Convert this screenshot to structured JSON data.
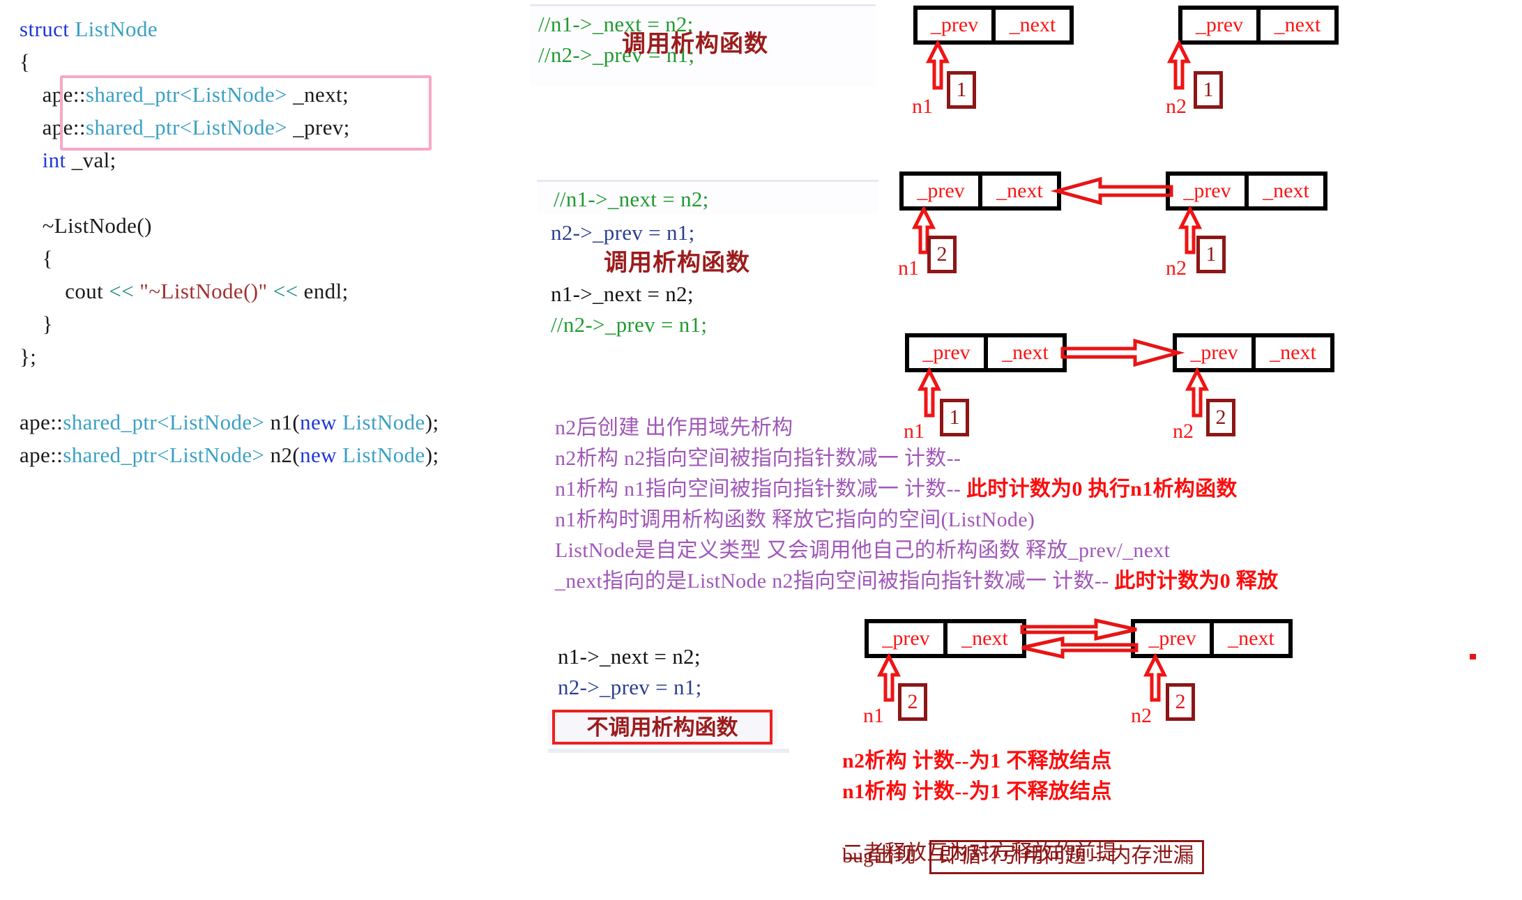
{
  "code_listing": {
    "lines": [
      [
        {
          "t": "struct ",
          "c": "kw"
        },
        {
          "t": "ListNode",
          "c": "ty"
        }
      ],
      [
        {
          "t": "{",
          "c": ""
        }
      ],
      [
        {
          "t": "    ape::",
          "c": ""
        },
        {
          "t": "shared_ptr<ListNode>",
          "c": "ty"
        },
        {
          "t": " _next;",
          "c": ""
        }
      ],
      [
        {
          "t": "    ape::",
          "c": ""
        },
        {
          "t": "shared_ptr<ListNode>",
          "c": "ty"
        },
        {
          "t": " _prev;",
          "c": ""
        }
      ],
      [
        {
          "t": "    ",
          "c": ""
        },
        {
          "t": "int",
          "c": "kw"
        },
        {
          "t": " _val;",
          "c": ""
        }
      ],
      [
        {
          "t": "",
          "c": ""
        }
      ],
      [
        {
          "t": "    ~ListNode()",
          "c": ""
        }
      ],
      [
        {
          "t": "    {",
          "c": ""
        }
      ],
      [
        {
          "t": "        cout ",
          "c": ""
        },
        {
          "t": "<<",
          "c": "op"
        },
        {
          "t": " ",
          "c": ""
        },
        {
          "t": "\"~ListNode()\"",
          "c": "str"
        },
        {
          "t": " ",
          "c": ""
        },
        {
          "t": "<<",
          "c": "op"
        },
        {
          "t": " endl;",
          "c": ""
        }
      ],
      [
        {
          "t": "    }",
          "c": ""
        }
      ],
      [
        {
          "t": "};",
          "c": ""
        }
      ],
      [
        {
          "t": "",
          "c": ""
        }
      ],
      [
        {
          "t": "ape::",
          "c": ""
        },
        {
          "t": "shared_ptr<ListNode>",
          "c": "ty"
        },
        {
          "t": " n1(",
          "c": ""
        },
        {
          "t": "new",
          "c": "kw"
        },
        {
          "t": " ",
          "c": ""
        },
        {
          "t": "ListNode",
          "c": "ty"
        },
        {
          "t": ");",
          "c": ""
        }
      ],
      [
        {
          "t": "ape::",
          "c": ""
        },
        {
          "t": "shared_ptr<ListNode>",
          "c": "ty"
        },
        {
          "t": " n2(",
          "c": ""
        },
        {
          "t": "new",
          "c": "kw"
        },
        {
          "t": " ",
          "c": ""
        },
        {
          "t": "ListNode",
          "c": "ty"
        },
        {
          "t": ");",
          "c": ""
        }
      ]
    ]
  },
  "snippet1": {
    "lines": [
      {
        "text": "//n1->_next = n2;",
        "style": "cmt"
      },
      {
        "text": "//n2->_prev = n1;",
        "style": "cmt"
      }
    ],
    "overlay": "调用析构函数"
  },
  "snippet2": {
    "lines_top": [
      {
        "text": "//n1->_next = n2;",
        "style": "cmt"
      }
    ],
    "lines_rest": [
      {
        "text": "n2->_prev = n1;",
        "style": "act"
      },
      {
        "text": "",
        "style": "act"
      },
      {
        "text": "n1->_next = n2;",
        "style": "act2"
      },
      {
        "text": "//n2->_prev = n1;",
        "style": "cmt"
      }
    ],
    "overlay": "调用析构函数"
  },
  "snippet3": {
    "lines": [
      {
        "text": "n1->_next = n2;",
        "style": "act2"
      },
      {
        "text": "n2->_prev = n1;",
        "style": "act"
      }
    ],
    "boxed_note": "不调用析构函数"
  },
  "purple_notes": [
    {
      "normal": "n2后创建 出作用域先析构",
      "hot": ""
    },
    {
      "normal": "n2析构 n2指向空间被指向指针数减一 计数--",
      "hot": ""
    },
    {
      "normal": "n1析构 n1指向空间被指向指针数减一 计数--  ",
      "hot": "此时计数为0 执行n1析构函数"
    },
    {
      "normal": "n1析构时调用析构函数 释放它指向的空间(ListNode)",
      "hot": ""
    },
    {
      "normal": "ListNode是自定义类型 又会调用他自己的析构函数 释放_prev/_next",
      "hot": ""
    },
    {
      "normal": "_next指向的是ListNode  n2指向空间被指向指针数减一 计数--  ",
      "hot": "此时计数为0 释放"
    }
  ],
  "red_notes": [
    {
      "text": "n2析构 计数--为1 不释放结点",
      "dark": false
    },
    {
      "text": "n1析构 计数--为1 不释放结点",
      "dark": false
    },
    {
      "text": "",
      "dark": true
    },
    {
      "text": "二者释放互为对方释放的前提",
      "dark": true
    }
  ],
  "bug_line": {
    "prefix": "bug出现",
    "boxed": "即循环引用问题 -- 内存泄漏"
  },
  "diagram": {
    "cell_prev": "_prev",
    "cell_next": "_next",
    "rows": [
      {
        "id": "row1",
        "left": {
          "ptr": "n1",
          "count": "1",
          "count_color": "dark"
        },
        "right": {
          "ptr": "n2",
          "count": "1",
          "count_color": "dark"
        },
        "arrows": []
      },
      {
        "id": "row2",
        "left": {
          "ptr": "n1",
          "count": "2",
          "count_color": "dark"
        },
        "right": {
          "ptr": "n2",
          "count": "1",
          "count_color": "dark"
        },
        "arrows": [
          "left"
        ]
      },
      {
        "id": "row3",
        "left": {
          "ptr": "n1",
          "count": "1",
          "count_color": "dark"
        },
        "right": {
          "ptr": "n2",
          "count": "2",
          "count_color": "dark"
        },
        "arrows": [
          "right"
        ]
      },
      {
        "id": "row4",
        "left": {
          "ptr": "n1",
          "count": "2",
          "count_color": "red"
        },
        "right": {
          "ptr": "n2",
          "count": "2",
          "count_color": "red"
        },
        "arrows": [
          "right",
          "left"
        ]
      }
    ]
  }
}
